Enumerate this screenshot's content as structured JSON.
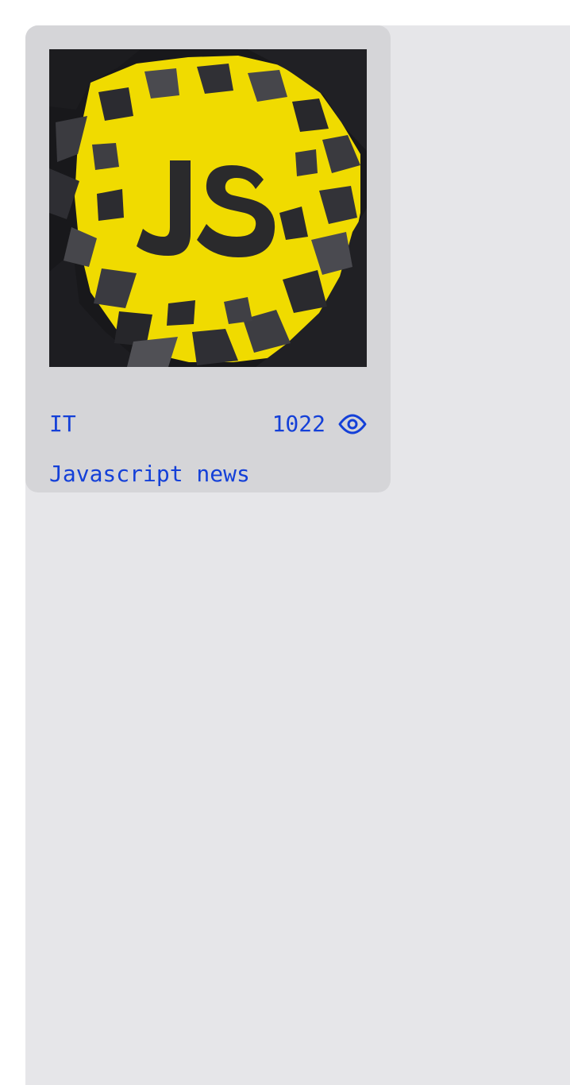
{
  "colors": {
    "page_background": "#ffffff",
    "panel_background": "#e6e6e9",
    "card_background": "#d5d5d8",
    "accent_text": "#1440d8",
    "image_yellow": "#f0db00",
    "image_dark": "#2a2a2c"
  },
  "card": {
    "image_label": "JS",
    "category": "IT",
    "views": "1022",
    "views_icon": "eye-icon",
    "title": "Javascript news"
  }
}
